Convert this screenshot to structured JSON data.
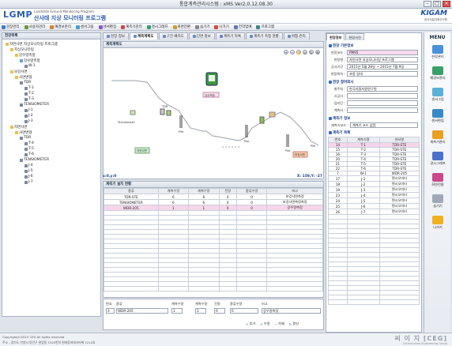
{
  "window": {
    "title": "통합계측관리시스템 : xMS Ver2.0.12.08.30"
  },
  "header": {
    "logo": "LGMP",
    "logo_sub": "Landslide Ground Monitoring Program",
    "logo_kr": "산사태 지상 모니터링 프로그램",
    "brand": "KIGAM",
    "brand_sub": "한국지질자원연구원"
  },
  "menubar": [
    {
      "label": "현장관리",
      "icon": "site-icon",
      "color": "#3b7dd8"
    },
    {
      "label": "사용자관리",
      "icon": "user-icon",
      "color": "#6a9a3a"
    },
    {
      "label": "예경보관리",
      "icon": "alarm-icon",
      "color": "#d8823b"
    },
    {
      "label": "센서그림",
      "icon": "sensor-icon",
      "color": "#4aa0c8"
    },
    {
      "label": "센서편집",
      "icon": "edit-icon",
      "color": "#8a5ac8"
    },
    {
      "label": "계측기관리",
      "icon": "meter-icon",
      "color": "#c84a4a"
    },
    {
      "label": "경시그래프",
      "icon": "graph-icon",
      "color": "#3aa06a"
    },
    {
      "label": "화면전환",
      "icon": "switch-icon",
      "color": "#c8a03a"
    },
    {
      "label": "숨기기",
      "icon": "hide-icon",
      "color": "#888888"
    },
    {
      "label": "나가기",
      "icon": "exit-icon",
      "color": "#d84a3a"
    },
    {
      "label": "전작업예",
      "icon": "prev-icon",
      "color": "#5a7ab8"
    },
    {
      "label": "프로그램",
      "icon": "program-icon",
      "color": "#3a8a8a"
    }
  ],
  "tree": {
    "title": "현장목록",
    "nodes": [
      {
        "label": "자연사면 지상모니터링 프로그램",
        "depth": 0,
        "icon": "folder-icon"
      },
      {
        "label": "지상모니터링",
        "depth": 1,
        "icon": "folder-icon"
      },
      {
        "label": "강우량측정",
        "depth": 2,
        "icon": "folder-icon"
      },
      {
        "label": "강우량측정",
        "depth": 3,
        "icon": "gauge-icon"
      },
      {
        "label": "W-1",
        "depth": 4,
        "icon": "sensor-icon"
      },
      {
        "label": "보강사면",
        "depth": 1,
        "icon": "folder-icon"
      },
      {
        "label": "사면변형",
        "depth": 2,
        "icon": "folder-icon"
      },
      {
        "label": "TDR",
        "depth": 3,
        "icon": "sensor-icon"
      },
      {
        "label": "T-1",
        "depth": 4,
        "icon": "sensor-icon"
      },
      {
        "label": "T-2",
        "depth": 4,
        "icon": "sensor-icon"
      },
      {
        "label": "T-3",
        "depth": 4,
        "icon": "sensor-icon"
      },
      {
        "label": "TENSIOMETER",
        "depth": 3,
        "icon": "sensor-icon"
      },
      {
        "label": "J-1",
        "depth": 4,
        "icon": "sensor-icon"
      },
      {
        "label": "J-2",
        "depth": 4,
        "icon": "sensor-icon"
      },
      {
        "label": "J-3",
        "depth": 4,
        "icon": "sensor-icon"
      },
      {
        "label": "자연사면",
        "depth": 1,
        "icon": "folder-icon"
      },
      {
        "label": "사면변형",
        "depth": 2,
        "icon": "folder-icon"
      },
      {
        "label": "TDR",
        "depth": 3,
        "icon": "sensor-icon"
      },
      {
        "label": "T-4",
        "depth": 4,
        "icon": "sensor-icon"
      },
      {
        "label": "T-5",
        "depth": 4,
        "icon": "sensor-icon"
      },
      {
        "label": "T-6",
        "depth": 4,
        "icon": "sensor-icon"
      },
      {
        "label": "TENSIOMETER",
        "depth": 3,
        "icon": "sensor-icon"
      },
      {
        "label": "J-4",
        "depth": 4,
        "icon": "sensor-icon"
      },
      {
        "label": "J-5",
        "depth": 4,
        "icon": "sensor-icon"
      },
      {
        "label": "J-6",
        "depth": 4,
        "icon": "sensor-icon"
      },
      {
        "label": "J-7",
        "depth": 4,
        "icon": "sensor-icon"
      }
    ]
  },
  "center_tabs": [
    {
      "label": "현장 정보",
      "active": false
    },
    {
      "label": "계측계획도",
      "active": true
    },
    {
      "label": "구간 배치도",
      "active": false
    },
    {
      "label": "단면 정보",
      "active": false
    },
    {
      "label": "계측기 목록",
      "active": false
    },
    {
      "label": "계측기 측정 현황",
      "active": false
    },
    {
      "label": "위험 관리",
      "active": false
    }
  ],
  "map": {
    "title": "계측계획도",
    "labels": {
      "tensiometer": "Tensiometer",
      "tdr": "TDR",
      "pile1": "Pile",
      "pile2": "Pile",
      "pile3": "Pile",
      "pile4": "Pile",
      "logger": "강우측정",
      "box1": "자연사면",
      "box2": "보강사면"
    },
    "coords_left": "x:0,y:0",
    "coords_right": "X: 159,Y: -27"
  },
  "grid": {
    "title": "계측기 설치 현황",
    "headers": [
      "종류",
      "계측수량",
      "계측수량",
      "전량",
      "종류수량",
      "비고"
    ],
    "rows": [
      {
        "cells": [
          "TDR-STE",
          "6",
          "6",
          "0",
          "0",
          "보강사면측정"
        ],
        "pink": false
      },
      {
        "cells": [
          "TENSIOMETER",
          "6",
          "6",
          "0",
          "0",
          "보강사면측정측정"
        ],
        "pink": false
      },
      {
        "cells": [
          "WDR-205",
          "1",
          "1",
          "0",
          "0",
          "강우량측정"
        ],
        "pink": true
      }
    ]
  },
  "form": {
    "headers": {
      "no": "번호",
      "type": "종류",
      "count1": "계측수량",
      "count2": "계측수량",
      "qty": "진량",
      "kind": "종류수량",
      "note": "비고"
    },
    "values": {
      "no": "3",
      "type": "WDR-205",
      "count1": "1",
      "count2": "1",
      "qty": "0",
      "kind": "0",
      "note": "강우량측정"
    },
    "buttons": {
      "add": "추가",
      "edit": "수정",
      "delete": "삭제",
      "refresh": "갱신"
    }
  },
  "right": {
    "tabs": [
      {
        "label": "현장정보",
        "active": true
      },
      {
        "label": "현장사진",
        "active": false
      }
    ],
    "basic_title": "현장 기본정보",
    "fields": [
      {
        "label": "현장코드 :",
        "value": "PM95",
        "pink": true
      },
      {
        "label": "현장명 :",
        "value": "자연사면 지상모니터링 프로그램",
        "pink": false
      },
      {
        "label": "공사기간 :",
        "value": "2015년 5월 28일 ~ 2015년 7월 9일",
        "pink": false
      },
      {
        "label": "현장위치 :",
        "value": "포항 일대",
        "pink": false
      }
    ],
    "company_title": "현장 참여회사",
    "company_fields": [
      {
        "label": "발주처 :",
        "value": "한국지질자원연구원"
      },
      {
        "label": "시공사 :",
        "value": ""
      },
      {
        "label": "감리단 :",
        "value": ""
      },
      {
        "label": "계측사 :",
        "value": ""
      }
    ],
    "meter_title": "계측기 정보",
    "meter_code_label": "계측기코드 :",
    "meter_code_value": "계측기 코드 없음",
    "list_title": "계측기 목록",
    "list_headers": [
      "번호",
      "계측기명",
      "센서명"
    ],
    "list_rows": [
      {
        "cells": [
          "14",
          "T-1",
          "TDR-STE"
        ],
        "pink": true
      },
      {
        "cells": [
          "15",
          "T-2",
          "TDR-STE"
        ],
        "pink": false
      },
      {
        "cells": [
          "16",
          "T-3",
          "TDR-STE"
        ],
        "pink": false
      },
      {
        "cells": [
          "20",
          "T-4",
          "TDR-STE"
        ],
        "pink": false
      },
      {
        "cells": [
          "21",
          "T-5",
          "TDR-STE"
        ],
        "pink": false
      },
      {
        "cells": [
          "22",
          "T-6",
          "TDR-STE"
        ],
        "pink": false
      },
      {
        "cells": [
          "7",
          "W-1",
          "WDR-205"
        ],
        "pink": false
      },
      {
        "cells": [
          "17",
          "J-1",
          "텐시오미터"
        ],
        "pink": false
      },
      {
        "cells": [
          "18",
          "J-2",
          "텐시오미터"
        ],
        "pink": false
      },
      {
        "cells": [
          "19",
          "J-3",
          "텐시오미터"
        ],
        "pink": false
      },
      {
        "cells": [
          "23",
          "J-4",
          "텐시오미터"
        ],
        "pink": false
      },
      {
        "cells": [
          "24",
          "J-5",
          "텐시오미터"
        ],
        "pink": false
      },
      {
        "cells": [
          "25",
          "J-6",
          "텐시오미터"
        ],
        "pink": false
      },
      {
        "cells": [
          "26",
          "J-7",
          "텐시오미터"
        ],
        "pink": false
      }
    ]
  },
  "sidemenu": {
    "title": "MENU",
    "items": [
      {
        "label": "현장관리",
        "icon": "site-icon",
        "color": "#4a90d9"
      },
      {
        "label": "예경보관리",
        "icon": "alarm-icon",
        "color": "#3aa06a"
      },
      {
        "label": "센서그림",
        "icon": "sensor-icon",
        "color": "#5ab0d8"
      },
      {
        "label": "센서편집",
        "icon": "edit-icon",
        "color": "#3a8ac8"
      },
      {
        "label": "계측기관리",
        "icon": "meter-icon",
        "color": "#e8a020"
      },
      {
        "label": "경시그래프",
        "icon": "graph-icon",
        "color": "#4a70c8"
      },
      {
        "label": "화면전환",
        "icon": "switch-icon",
        "color": "#c84a8a"
      },
      {
        "label": "숨기기",
        "icon": "hide-icon",
        "color": "#a0a8b8"
      },
      {
        "label": "나가기",
        "icon": "exit-icon",
        "color": "#f0b020"
      }
    ]
  },
  "status": {
    "copyright": "Copyright(c)2015 CEG All rights reserved",
    "address": "주소 : 경기도 안양시 동안구 관양동 1520번지 현대동지테크타워 1210호",
    "ceg": "씨 이 지 [CEG]",
    "ceg_sub": "Construction Engineering Group"
  }
}
